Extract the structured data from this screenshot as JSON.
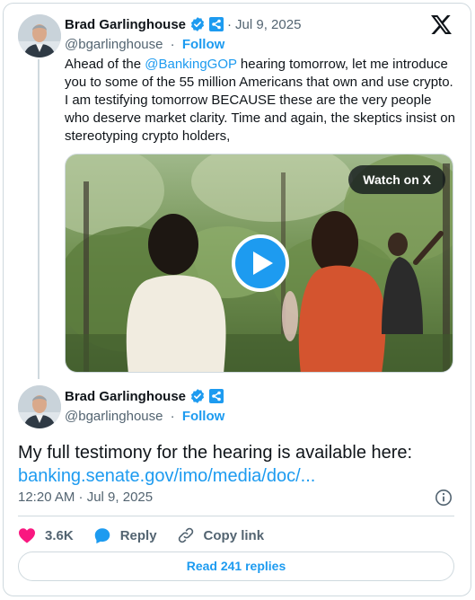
{
  "tweet": {
    "author": {
      "display_name": "Brad Garlinghouse",
      "handle": "@bgarlinghouse",
      "follow_label": "Follow",
      "verified": true
    },
    "separator": "·",
    "date": "Jul 9, 2025",
    "text_before": "Ahead of the ",
    "mention": "@BankingGOP",
    "text_after": " hearing tomorrow, let me introduce you to some of the 55 million Americans that own and use crypto. I am testifying tomorrow BECAUSE these are the very people who deserve market clarity. Time and again, the skeptics insist on stereotyping crypto holders,",
    "media": {
      "watch_label": "Watch on X"
    }
  },
  "reply": {
    "author": {
      "display_name": "Brad Garlinghouse",
      "handle": "@bgarlinghouse",
      "follow_label": "Follow"
    },
    "separator": "·",
    "text": "My full testimony for the hearing is available here:",
    "link": "banking.senate.gov/imo/media/doc/...",
    "timestamp": "12:20 AM · Jul 9, 2025",
    "actions": {
      "like_count": "3.6K",
      "reply_label": "Reply",
      "copy_label": "Copy link"
    },
    "read_replies_label": "Read 241 replies"
  },
  "colors": {
    "accent": "#1d9bf0",
    "like": "#f91880",
    "text": "#0f1419",
    "secondary": "#536471",
    "border": "#cfd9de"
  },
  "icons": [
    "verified-badge-icon",
    "affiliate-badge-icon",
    "x-logo-icon",
    "play-icon",
    "info-icon",
    "heart-icon",
    "reply-icon",
    "link-icon"
  ]
}
